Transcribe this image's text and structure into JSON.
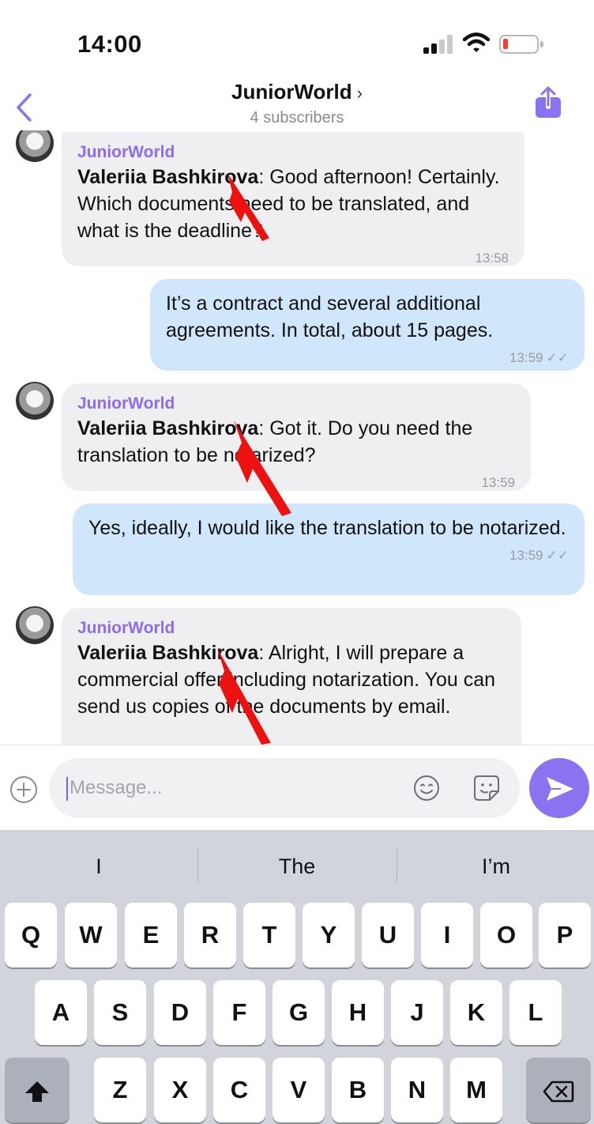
{
  "status_bar": {
    "time": "14:00"
  },
  "header": {
    "title": "JuniorWorld",
    "title_chevron": "›",
    "subtitle": "4 subscribers",
    "back_icon": "chevron-left-icon",
    "share_icon": "share-icon"
  },
  "messages": [
    {
      "direction": "incoming",
      "channel": "JuniorWorld",
      "sender": "Valeriia Bashkirova",
      "text": ": Good afternoon! Certainly. Which documents need to be translated, and what is the deadline?",
      "time": "13:58"
    },
    {
      "direction": "outgoing",
      "text": "It’s a contract and several additional agreements. In total, about 15 pages.",
      "time": "13:59",
      "status": "read"
    },
    {
      "direction": "incoming",
      "channel": "JuniorWorld",
      "sender": "Valeriia Bashkirova",
      "text": ": Got it. Do you need the translation to be notarized?",
      "time": "13:59"
    },
    {
      "direction": "outgoing",
      "text": "Yes, ideally, I would like the translation to be notarized.",
      "time": "13:59",
      "status": "read"
    },
    {
      "direction": "incoming",
      "channel": "JuniorWorld",
      "sender": "Valeriia Bashkirova",
      "text": ": Alright, I will prepare a commercial offer including notarization. You can send us copies of the documents by email.",
      "time": ""
    }
  ],
  "composer": {
    "placeholder": "Message...",
    "value": "",
    "plus_icon": "plus-circle-icon",
    "emoji_icon": "emoji-icon",
    "sticker_icon": "sticker-icon",
    "send_icon": "send-icon"
  },
  "keyboard": {
    "suggestions": [
      "I",
      "The",
      "I’m"
    ],
    "row1": [
      "Q",
      "W",
      "E",
      "R",
      "T",
      "Y",
      "U",
      "I",
      "O",
      "P"
    ],
    "row2": [
      "A",
      "S",
      "D",
      "F",
      "G",
      "H",
      "J",
      "K",
      "L"
    ],
    "row3": [
      "Z",
      "X",
      "C",
      "V",
      "B",
      "N",
      "M"
    ],
    "shift_icon": "shift-icon",
    "backspace_icon": "backspace-icon"
  },
  "colors": {
    "accent": "#8a72f0",
    "incoming_bubble": "#efeff1",
    "outgoing_bubble": "#d0e6fb",
    "channel_name": "#8c6cf0",
    "annotation_arrow": "#ee1111"
  }
}
